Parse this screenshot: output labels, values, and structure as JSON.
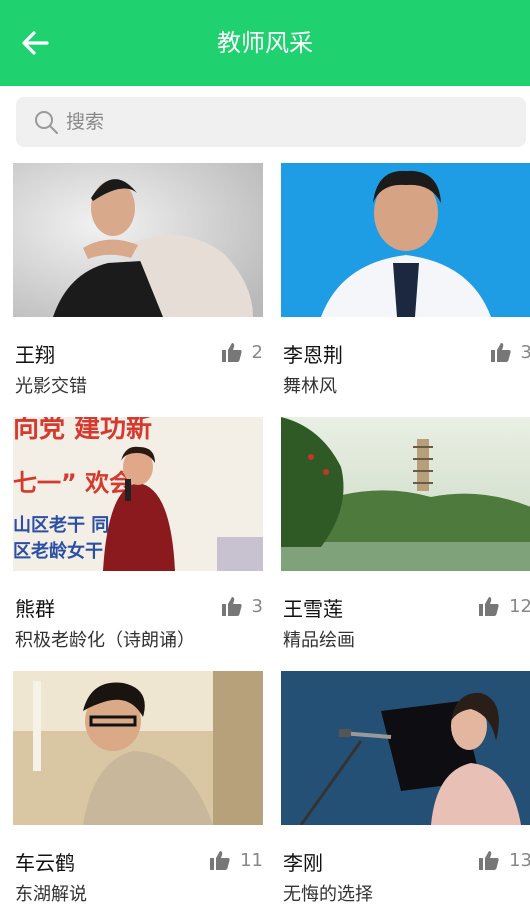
{
  "header": {
    "title": "教师风采",
    "back_icon": "arrow-left-icon",
    "color": "#1fd16f"
  },
  "search": {
    "placeholder": "搜索",
    "icon": "search-icon"
  },
  "teachers": [
    {
      "name": "王翔",
      "subtitle": "光影交错",
      "likes": "2"
    },
    {
      "name": "李恩荆",
      "subtitle": "舞林风",
      "likes": "3"
    },
    {
      "name": "熊群",
      "subtitle": "积极老龄化（诗朗诵）",
      "likes": "3"
    },
    {
      "name": "王雪莲",
      "subtitle": "精品绘画",
      "likes": "12"
    },
    {
      "name": "车云鹤",
      "subtitle": "东湖解说",
      "likes": "11"
    },
    {
      "name": "李刚",
      "subtitle": "无悔的选择",
      "likes": "13"
    }
  ],
  "card_texts": {
    "banner_line1": "向党  建功新",
    "banner_line2": "七一”        欢会",
    "banner_line3": "山区老干        同",
    "banner_line4": "区老龄女干        谊会"
  }
}
